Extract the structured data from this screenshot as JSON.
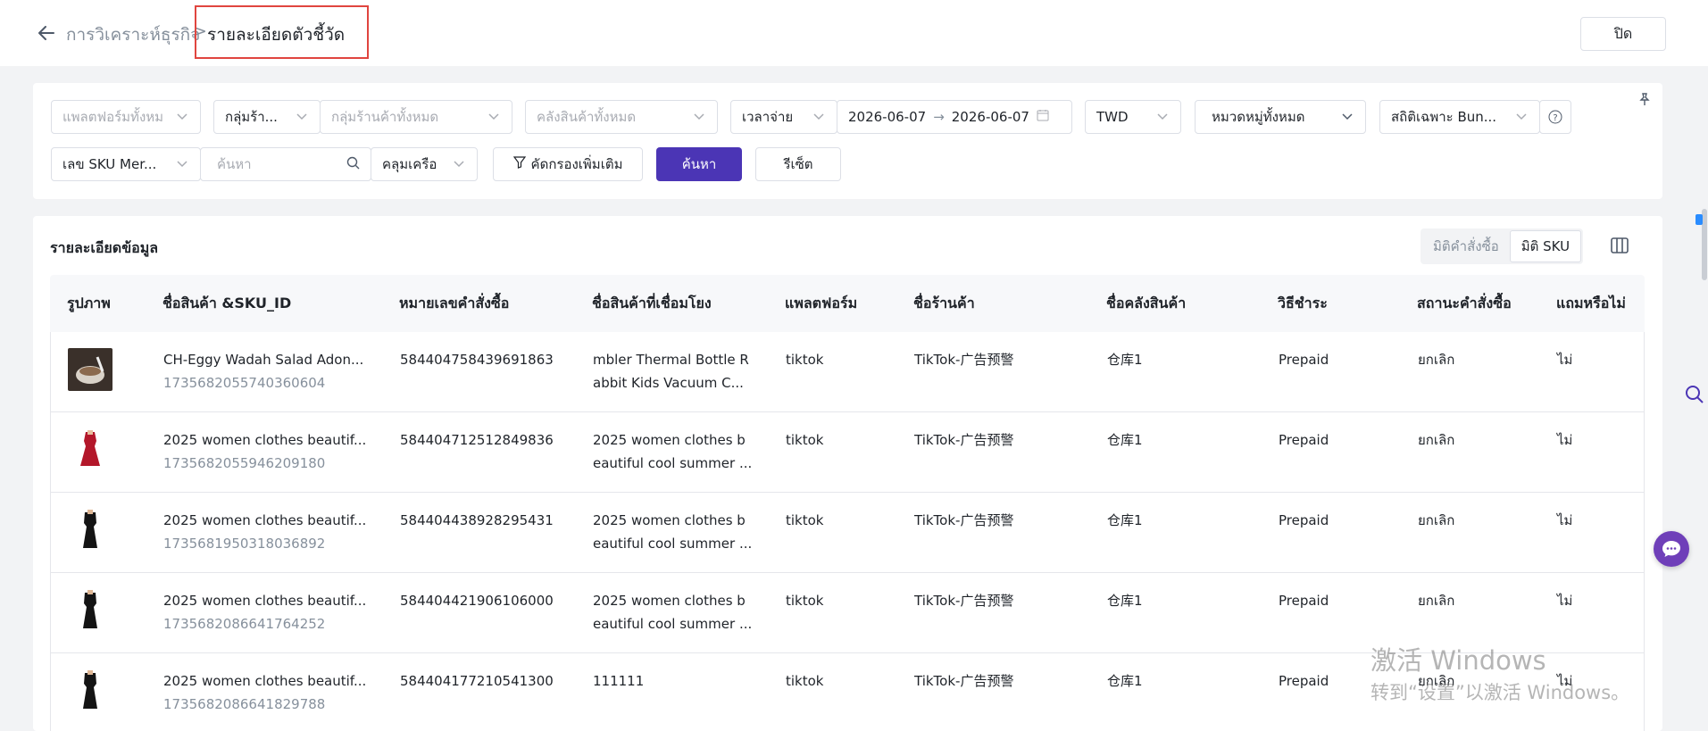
{
  "breadcrumb": {
    "parent": "การวิเคราะห์ธุรกิจ",
    "separator": ">",
    "current": "รายละเอียดตัวชี้วัด"
  },
  "close_label": "ปิด",
  "filters": {
    "platform": "แพลตฟอร์มทั้งหม",
    "store_group_short": "กลุ่มร้า...",
    "store_group_all": "กลุ่มร้านค้าทั้งหมด",
    "warehouse": "คลังสินค้าทั้งหมด",
    "time_type": "เวลาจ่าย",
    "date_start": "2026-06-07",
    "date_arrow": "→",
    "date_end": "2026-06-07",
    "currency": "TWD",
    "category": "หมวดหมู่ทั้งหมด",
    "stat_mode": "สถิติเฉพาะ Bun...",
    "sku_type": "เลข SKU Mer...",
    "search_placeholder": "ค้นหา",
    "match_mode": "คลุมเครือ",
    "more_filter": "คัดกรองเพิ่มเติม",
    "search_button": "ค้นหา",
    "reset_button": "รีเซ็ต"
  },
  "section_title": "รายละเอียดข้อมูล",
  "dimension_tabs": [
    "มิติคำสั่งซื้อ",
    "มิติ SKU"
  ],
  "table": {
    "headers": [
      "รูปภาพ",
      "ชื่อสินค้า &SKU_ID",
      "หมายเลขคำสั่งซื้อ",
      "ชื่อสินค้าที่เชื่อมโยง",
      "แพลตฟอร์ม",
      "ชื่อร้านค้า",
      "ชื่อคลังสินค้า",
      "วิธีชำระ",
      "สถานะคำสั่งซื้อ",
      "แถมหรือไม่"
    ],
    "rows": [
      {
        "image": "food-bowl-image",
        "name": "CH-Eggy Wadah Salad Adon...",
        "sku_id": "1735682055740360604",
        "order_no": "584404758439691863",
        "linked1": "mbler Thermal Bottle R",
        "linked2": "abbit Kids Vacuum C...",
        "platform": "tiktok",
        "store": "TikTok-广告预警",
        "warehouse": "仓库1",
        "payment": "Prepaid",
        "status": "ยกเลิก",
        "gift": "ไม่"
      },
      {
        "image": "red-dress-image",
        "name": "2025 women clothes beautif...",
        "sku_id": "1735682055946209180",
        "order_no": "584404712512849836",
        "linked1": "2025 women clothes b",
        "linked2": "eautiful cool summer ...",
        "platform": "tiktok",
        "store": "TikTok-广告预警",
        "warehouse": "仓库1",
        "payment": "Prepaid",
        "status": "ยกเลิก",
        "gift": "ไม่"
      },
      {
        "image": "black-dress-image",
        "name": "2025 women clothes beautif...",
        "sku_id": "1735681950318036892",
        "order_no": "584404438928295431",
        "linked1": "2025 women clothes b",
        "linked2": "eautiful cool summer ...",
        "platform": "tiktok",
        "store": "TikTok-广告预警",
        "warehouse": "仓库1",
        "payment": "Prepaid",
        "status": "ยกเลิก",
        "gift": "ไม่"
      },
      {
        "image": "black-dress-image",
        "name": "2025 women clothes beautif...",
        "sku_id": "1735682086641764252",
        "order_no": "584404421906106000",
        "linked1": "2025 women clothes b",
        "linked2": "eautiful cool summer ...",
        "platform": "tiktok",
        "store": "TikTok-广告预警",
        "warehouse": "仓库1",
        "payment": "Prepaid",
        "status": "ยกเลิก",
        "gift": "ไม่"
      },
      {
        "image": "black-dress-image",
        "name": "2025 women clothes beautif...",
        "sku_id": "1735682086641829788",
        "order_no": "584404177210541300",
        "linked1": "111111",
        "linked2": "",
        "platform": "tiktok",
        "store": "TikTok-广告预警",
        "warehouse": "仓库1",
        "payment": "Prepaid",
        "status": "ยกเลิก",
        "gift": "ไม่"
      }
    ]
  },
  "watermark": {
    "line1": "激活 Windows",
    "line2": "转到“设置”以激活 Windows。"
  },
  "colors": {
    "primary": "#4b35b5",
    "highlight_border": "#e0453f",
    "chat_button": "#6f3fb9"
  }
}
